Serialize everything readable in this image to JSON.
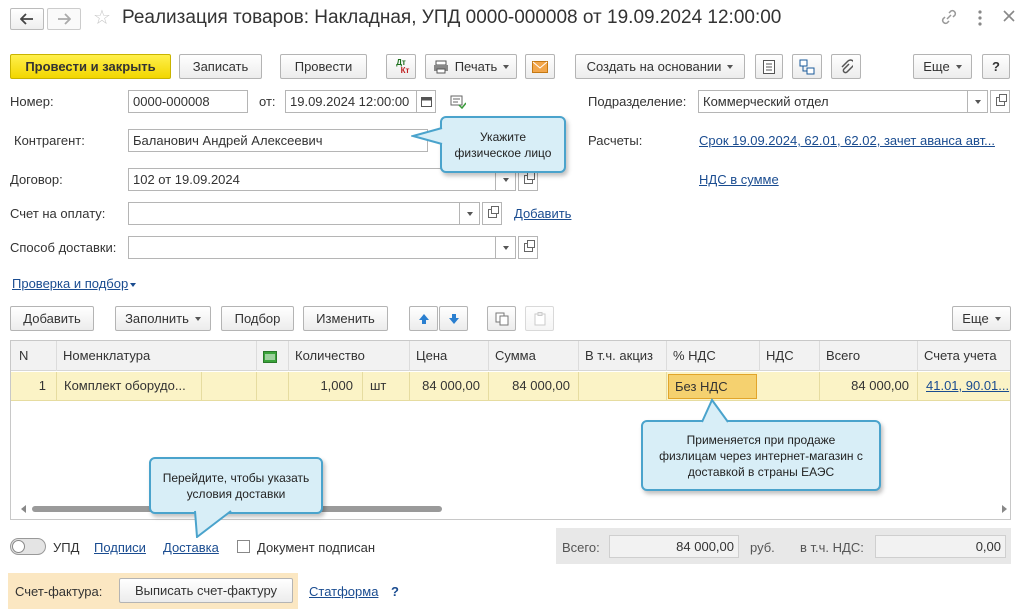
{
  "window": {
    "title": "Реализация товаров: Накладная, УПД 0000-000008 от 19.09.2024 12:00:00"
  },
  "toolbar": {
    "post_close": "Провести и закрыть",
    "save": "Записать",
    "post": "Провести",
    "dtkt_top": "Дт",
    "dtkt_bottom": "Кт",
    "print": "Печать",
    "create_based": "Создать на основании",
    "more": "Еще",
    "help": "?"
  },
  "form": {
    "number_label": "Номер:",
    "number_value": "0000-000008",
    "date_label": "от:",
    "date_value": "19.09.2024 12:00:00",
    "division_label": "Подразделение:",
    "division_value": "Коммерческий отдел",
    "counterparty_label": "Контрагент:",
    "counterparty_value": "Баланович Андрей Алексеевич",
    "settlements_label": "Расчеты:",
    "settlements_link": "Срок 19.09.2024, 62.01, 62.02, зачет аванса авт...",
    "contract_label": "Договор:",
    "contract_value": "102 от 19.09.2024",
    "vat_link": "НДС в сумме",
    "invoice_label": "Счет на оплату:",
    "invoice_add": "Добавить",
    "delivery_label": "Способ доставки:",
    "check_link": "Проверка и подбор"
  },
  "table_toolbar": {
    "add": "Добавить",
    "fill": "Заполнить",
    "pick": "Подбор",
    "change": "Изменить",
    "more": "Еще"
  },
  "table": {
    "headers": {
      "n": "N",
      "item": "Номенклатура",
      "qty": "Количество",
      "price": "Цена",
      "sum": "Сумма",
      "excise": "В т.ч. акциз",
      "vat_rate": "% НДС",
      "vat": "НДС",
      "total": "Всего",
      "account": "Счета учета"
    },
    "rows": [
      {
        "n": "1",
        "item": "Комплект оборудо...",
        "qty": "1,000",
        "unit": "шт",
        "price": "84 000,00",
        "sum": "84 000,00",
        "excise": "",
        "vat_rate": "Без НДС",
        "vat": "",
        "total": "84 000,00",
        "account": "41.01, 90.01..."
      }
    ]
  },
  "tooltips": {
    "counterparty": "Укажите физическое лицо",
    "vat": "Применяется при продаже физлицам через интернет-магазин с доставкой в страны ЕАЭС",
    "delivery": "Перейдите, чтобы указать условия доставки"
  },
  "footer": {
    "upd_label": "УПД",
    "signatures_link": "Подписи",
    "delivery_link": "Доставка",
    "signed_label": "Документ подписан",
    "total_label": "Всего:",
    "total_value": "84 000,00",
    "currency": "руб.",
    "vat_label": "в т.ч. НДС:",
    "vat_value": "0,00",
    "sf_label": "Счет-фактура:",
    "sf_button": "Выписать счет-фактуру",
    "statform_link": "Статформа",
    "question": "?"
  },
  "colors": {
    "primary_button": "#f2d600",
    "link": "#1a4c90",
    "tooltip_bg": "#d8eef7",
    "tooltip_border": "#4aa3cc",
    "selected_row": "#fbf3c6",
    "vat_cell": "#f5d16f"
  }
}
